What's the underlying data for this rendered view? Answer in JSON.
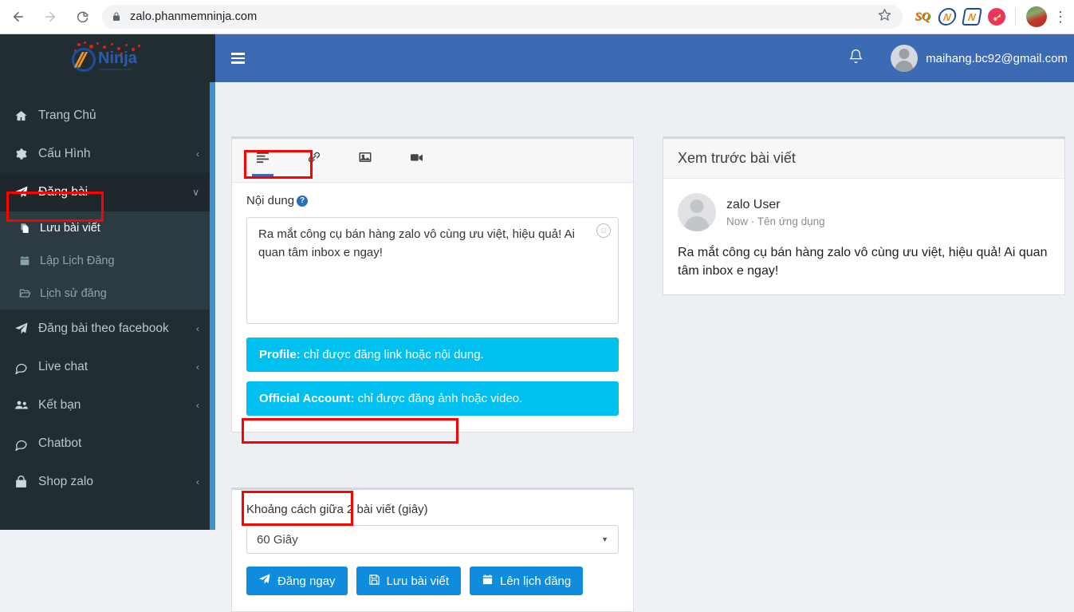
{
  "browser": {
    "back_icon": "back-arrow-icon",
    "forward_icon": "forward-arrow-icon",
    "reload_icon": "reload-icon",
    "lock_icon": "lock-icon",
    "url": "zalo.phanmemninja.com",
    "star_icon": "bookmark-star-icon",
    "extensions": [
      {
        "name": "sq-extension-icon",
        "label": "SQ"
      },
      {
        "name": "ninja-extension-icon",
        "label": "N"
      },
      {
        "name": "ninja-extension-icon-2",
        "label": "N"
      },
      {
        "name": "key-extension-icon",
        "label": ""
      }
    ],
    "profile_icon": "chrome-profile-avatar",
    "menu_icon": "chrome-menu-kebab-icon"
  },
  "sidebar": {
    "logo": {
      "text": "Ninja",
      "subtext": "phanmemninja.com"
    },
    "items": [
      {
        "label": "Trang Chủ",
        "icon": "home-icon",
        "arrow": "",
        "active": false
      },
      {
        "label": "Cấu Hình",
        "icon": "gear-icon",
        "arrow": "‹",
        "active": false
      },
      {
        "label": "Đăng bài",
        "icon": "paper-plane-icon",
        "arrow": "∨",
        "active": true
      },
      {
        "label": "Đăng bài theo facebook",
        "icon": "paper-plane-icon",
        "arrow": "‹",
        "active": false
      },
      {
        "label": "Live chat",
        "icon": "comment-icon",
        "arrow": "‹",
        "active": false
      },
      {
        "label": "Kết bạn",
        "icon": "users-icon",
        "arrow": "‹",
        "active": false
      },
      {
        "label": "Chatbot",
        "icon": "comment-icon",
        "arrow": "",
        "active": false
      },
      {
        "label": "Shop zalo",
        "icon": "shop-bag-icon",
        "arrow": "‹",
        "active": false
      }
    ],
    "submenu": [
      {
        "label": "Lưu bài viết",
        "icon": "copy-files-icon",
        "active": true
      },
      {
        "label": "Lập Lịch Đăng",
        "icon": "calendar-icon",
        "active": false
      },
      {
        "label": "Lịch sử đăng",
        "icon": "folder-open-icon",
        "active": false
      }
    ]
  },
  "topbar": {
    "menu_toggle_icon": "hamburger-menu-icon",
    "bell_icon": "notification-bell-icon",
    "avatar_icon": "user-avatar",
    "email": "maihang.bc92@gmail.com"
  },
  "editor": {
    "tabs": [
      {
        "name": "tab-text",
        "icon": "text-align-icon",
        "active": true
      },
      {
        "name": "tab-link",
        "icon": "link-icon",
        "active": false
      },
      {
        "name": "tab-image",
        "icon": "image-icon",
        "active": false
      },
      {
        "name": "tab-video",
        "icon": "video-camera-icon",
        "active": false
      }
    ],
    "content_label": "Nội dung",
    "help_icon": "question-mark-icon",
    "content_value": "Ra mắt công cụ bán hàng zalo vô cùng ưu việt, hiệu quả! Ai quan tâm inbox e ngay!",
    "content_placeholder": "",
    "emoji_icon": "smiley-face-icon",
    "alerts": [
      {
        "strong": "Profile:",
        "text": " chỉ được đăng link hoặc nội dung."
      },
      {
        "strong": "Official Account:",
        "text": " chỉ được đăng ảnh hoặc video."
      }
    ]
  },
  "schedule": {
    "interval_label": "Khoảng cách giữa 2 bài viết (giây)",
    "interval_value": "60 Giây",
    "caret_icon": "chevron-down-icon",
    "buttons": [
      {
        "label": "Đăng ngay",
        "icon": "paper-plane-icon",
        "name": "post-now-button"
      },
      {
        "label": "Lưu bài viết",
        "icon": "save-disk-icon",
        "name": "save-post-button"
      },
      {
        "label": "Lên lịch đăng",
        "icon": "calendar-icon",
        "name": "schedule-post-button"
      }
    ]
  },
  "preview": {
    "title": "Xem trước bài viết",
    "user_name": "zalo User",
    "meta": "Now · Tên ứng dụng",
    "text": "Ra mắt công cụ bán hàng zalo vô cùng ưu việt, hiệu quả! Ai quan tâm inbox e ngay!"
  },
  "colors": {
    "header_blue": "#3c6bb4",
    "sidebar_dark": "#222d32",
    "sidebar_active": "#1e282c",
    "submenu_bg": "#2c3b41",
    "alert_cyan": "#00c0ef",
    "button_blue": "#0d8ddb",
    "annotation_red": "#ff0000",
    "scrollbar_blue": "#3b93d0"
  }
}
